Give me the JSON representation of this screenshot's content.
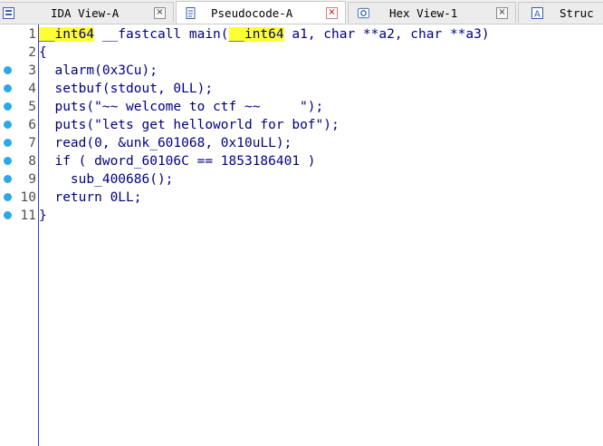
{
  "tabs": [
    {
      "label": "IDA View-A",
      "icon": "ida-view-icon",
      "active": false
    },
    {
      "label": "Pseudocode-A",
      "icon": "pseudocode-icon",
      "active": true
    },
    {
      "label": "Hex View-1",
      "icon": "hex-view-icon",
      "active": false
    },
    {
      "label": "Struc",
      "icon": "structures-icon",
      "active": false
    }
  ],
  "close_glyph": "×",
  "gutter": {
    "line_numbers": [
      "1",
      "2",
      "3",
      "4",
      "5",
      "6",
      "7",
      "8",
      "9",
      "10",
      "11"
    ],
    "breakpoint_lines": [
      3,
      4,
      5,
      6,
      7,
      8,
      9,
      10,
      11
    ],
    "breakpoint_color": "#2aa8e8"
  },
  "code": {
    "line1": {
      "type_a": "__int64",
      "call": " __fastcall main(",
      "type_b": "__int64",
      "args": " a1, char **a2, char **a3)"
    },
    "line2": "{",
    "line3": "  alarm(0x3Cu);",
    "line4": "  setbuf(stdout, 0LL);",
    "line5": "  puts(\"~~ welcome to ctf ~~     \");",
    "line6": "  puts(\"lets get helloworld for bof\");",
    "line7": "  read(0, &unk_601068, 0x10uLL);",
    "line8": "  if ( dword_60106C == 1853186401 )",
    "line9": "    sub_400686();",
    "line10": "  return 0LL;",
    "line11": "}"
  },
  "colors": {
    "highlight": "#ffff33",
    "code_text": "#000080",
    "gutter_line": "#3a3ad8"
  }
}
